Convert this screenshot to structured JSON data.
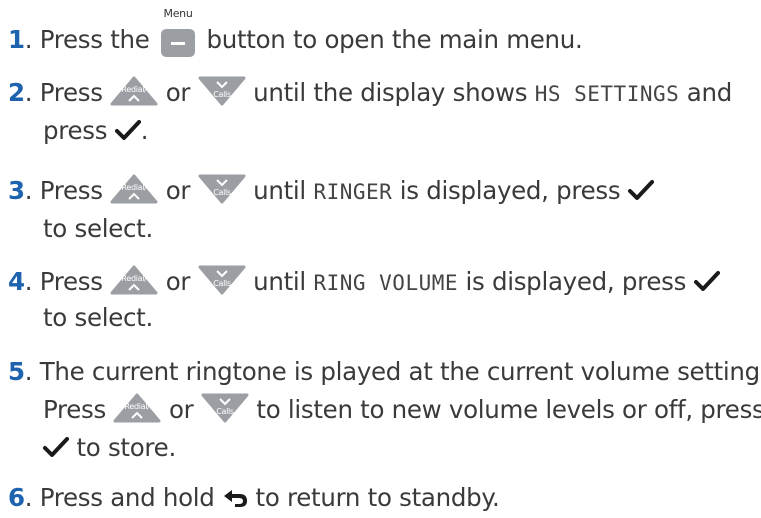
{
  "icons": {
    "menu_button": "menu-button-icon",
    "redial_up": "redial-up-key-icon",
    "calls_down": "calls-down-key-icon",
    "ok_tick": "ok-tick-icon",
    "back": "back-arrow-icon"
  },
  "colors": {
    "step_number": "#1d63ad",
    "key_grey": "#9b9ea3",
    "text": "#3a3a3a"
  },
  "key_labels": {
    "menu": "Menu",
    "redial": "Redial/",
    "calls": "Calls"
  },
  "steps": [
    {
      "num": "1",
      "dot": ".",
      "t1": " Press the ",
      "t2": " button to open the main menu."
    },
    {
      "num": "2",
      "dot": ".",
      "t1": " Press ",
      "t2": " or ",
      "t3": " until the display shows ",
      "lcd": "HS SETTINGS",
      "t4": " and",
      "l2a": "press ",
      "l2b": "."
    },
    {
      "num": "3",
      "dot": ".",
      "t1": " Press ",
      "t2": " or ",
      "t3": " until ",
      "lcd": "RINGER",
      "t4": " is displayed, press ",
      "l2": "to select."
    },
    {
      "num": "4",
      "dot": ".",
      "t1": " Press ",
      "t2": " or ",
      "t3": " until ",
      "lcd": "RING VOLUME",
      "t4": " is displayed, press ",
      "l2": "to select."
    },
    {
      "num": "5",
      "dot": ".",
      "l1": " The current ringtone is played at the current volume setting.",
      "l2a": "Press ",
      "l2b": " or ",
      "l2c": " to listen to new volume levels or off, press",
      "l3": " to store."
    },
    {
      "num": "6",
      "dot": ".",
      "t1": " Press and hold ",
      "t2": " to return to standby."
    }
  ]
}
